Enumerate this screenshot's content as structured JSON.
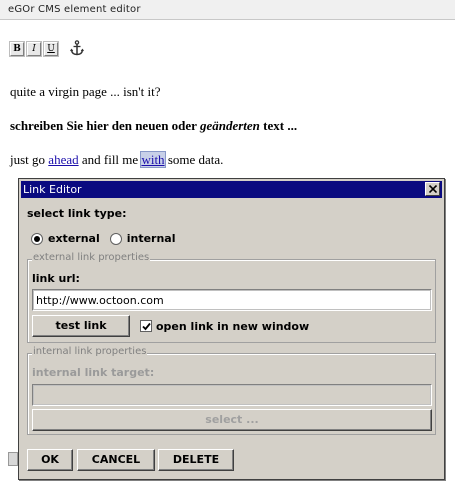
{
  "app": {
    "title": "eGOr CMS element editor"
  },
  "toolbar": {
    "bold_label": "B",
    "italic_label": "I",
    "underline_label": "U",
    "anchor_icon": "anchor-icon"
  },
  "document": {
    "para1": "quite a virgin page ... isn't it?",
    "para2_before": "schreiben Sie hier den neuen oder ",
    "para2_italic": "geänderten",
    "para2_after": " text ...",
    "para3_start": "just go ",
    "para3_link1": "ahead",
    "para3_mid": " and fill me ",
    "para3_link2": "with",
    "para3_end": " some data."
  },
  "dialog": {
    "title": "Link Editor",
    "link_type_label": "select link type:",
    "radio_external": "external",
    "radio_internal": "internal",
    "selected_type": "external",
    "external_legend": "external link properties",
    "url_label": "link url:",
    "url_value": "http://www.octoon.com",
    "test_link": "test link",
    "new_window_label": "open link in new window",
    "new_window_checked": true,
    "internal_legend": "internal link properties",
    "internal_target_label": "internal link target:",
    "internal_target_value": "",
    "select_button": "select ...",
    "ok": "OK",
    "cancel": "CANCEL",
    "delete": "DELETE"
  },
  "colors": {
    "dialog_title_bg": "#0a0a80",
    "dialog_bg": "#d4d0c8",
    "link": "#1a0dab",
    "selection": "#c8d0e8"
  }
}
